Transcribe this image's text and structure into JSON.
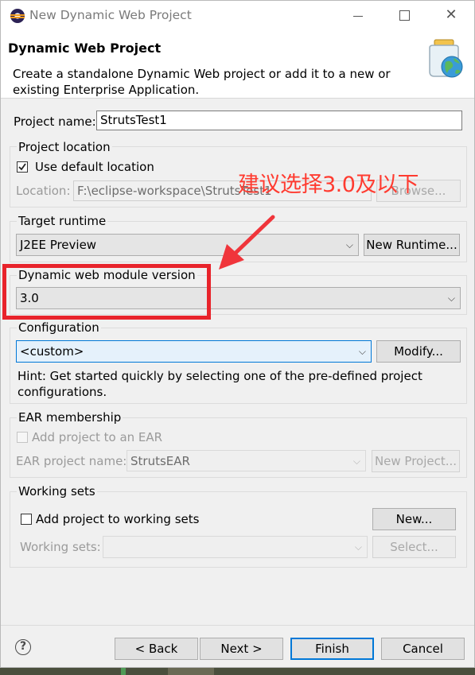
{
  "window": {
    "title": "New Dynamic Web Project",
    "controls": [
      "minimize-icon",
      "maximize-icon",
      "close-icon"
    ]
  },
  "banner": {
    "title": "Dynamic Web Project",
    "description": "Create a standalone Dynamic Web project or add it to a new or existing Enterprise Application.",
    "icon": "web-project-jar-globe-icon"
  },
  "project_name": {
    "label": "Project name:",
    "value": "StrutsTest1"
  },
  "project_location": {
    "group_title": "Project location",
    "use_default_label": "Use default location",
    "use_default_checked": true,
    "location_label": "Location:",
    "location_value": "F:\\eclipse-workspace\\StrutsTest1",
    "browse_label": "Browse..."
  },
  "target_runtime": {
    "group_title": "Target runtime",
    "selected": "J2EE Preview",
    "new_runtime_label": "New Runtime..."
  },
  "module_version": {
    "group_title": "Dynamic web module version",
    "selected": "3.0"
  },
  "configuration": {
    "group_title": "Configuration",
    "selected": "<custom>",
    "modify_label": "Modify...",
    "hint": "Hint: Get started quickly by selecting one of the pre-defined project configurations."
  },
  "ear": {
    "group_title": "EAR membership",
    "add_label": "Add project to an EAR",
    "add_checked": false,
    "name_label": "EAR project name:",
    "name_value": "StrutsEAR",
    "new_project_label": "New Project..."
  },
  "working_sets": {
    "group_title": "Working sets",
    "add_label": "Add project to working sets",
    "add_checked": false,
    "new_label": "New...",
    "sets_label": "Working sets:",
    "sets_value": "",
    "select_label": "Select..."
  },
  "footer": {
    "help_icon": "?",
    "back_label": "< Back",
    "next_label": "Next >",
    "finish_label": "Finish",
    "cancel_label": "Cancel"
  },
  "annotation": {
    "text": "建议选择3.0及以下",
    "color": "#ff3b30"
  }
}
